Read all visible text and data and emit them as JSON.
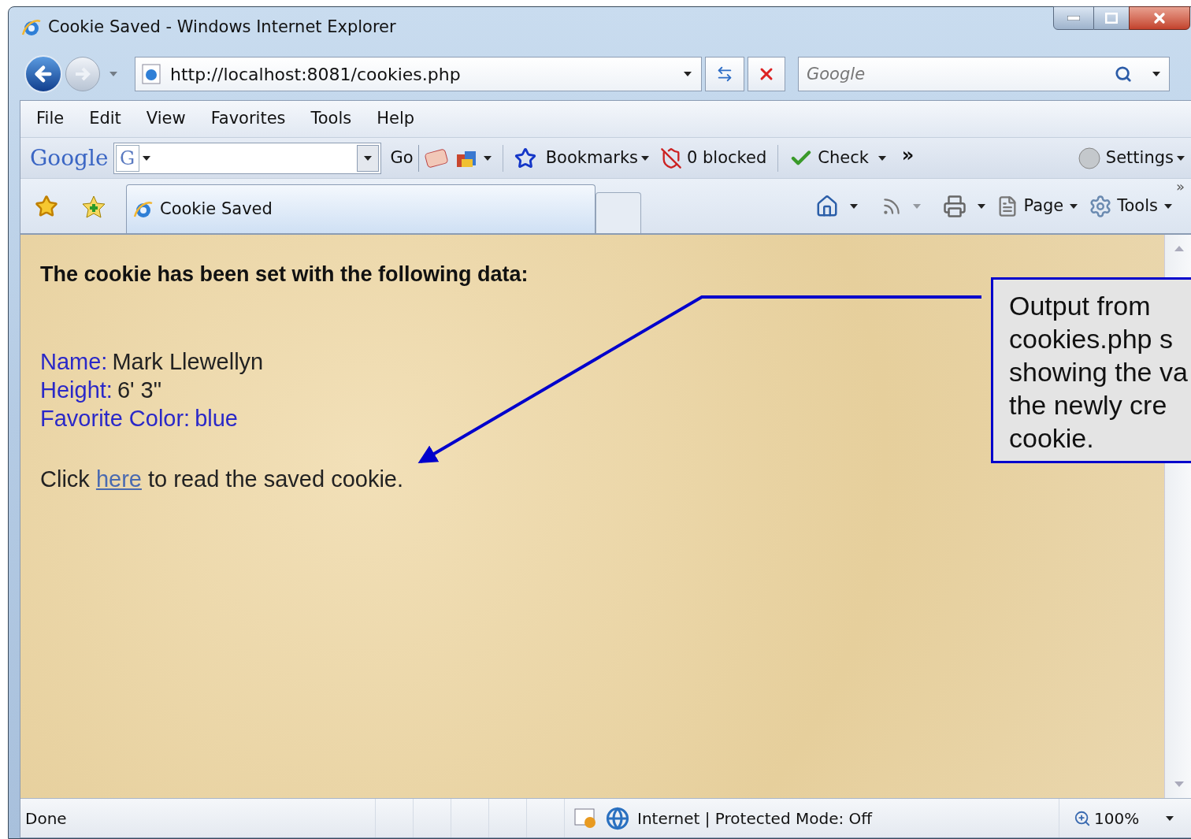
{
  "window": {
    "title": "Cookie Saved - Windows Internet Explorer"
  },
  "address_bar": {
    "url": "http://localhost:8081/cookies.php"
  },
  "search": {
    "placeholder": "Google"
  },
  "menu": [
    "File",
    "Edit",
    "View",
    "Favorites",
    "Tools",
    "Help"
  ],
  "google_toolbar": {
    "logo": "Google",
    "g_button": "G",
    "go": "Go",
    "bookmarks": "Bookmarks",
    "blocked": "0 blocked",
    "check": "Check",
    "more": "»",
    "settings": "Settings"
  },
  "tabs": [
    {
      "label": "Cookie Saved",
      "selected": true
    }
  ],
  "command_bar": {
    "page": "Page",
    "tools": "Tools",
    "more": "»"
  },
  "page": {
    "heading": "The cookie has been set with the following data:",
    "fields": [
      {
        "label": "Name:",
        "value": "Mark Llewellyn",
        "highlighted": false
      },
      {
        "label": "Height:",
        "value": "6' 3\"",
        "highlighted": false
      },
      {
        "label": "Favorite Color:",
        "value": "blue",
        "highlighted": true
      }
    ],
    "sentence": {
      "before": "Click",
      "link": "here",
      "after": "to read the saved cookie."
    }
  },
  "callout": {
    "lines": [
      "Output from",
      "cookies.php s",
      "showing the va",
      "the newly cre",
      "cookie."
    ]
  },
  "status_bar": {
    "status": "Done",
    "zone": "Internet | Protected Mode: Off",
    "zoom": "100%"
  }
}
